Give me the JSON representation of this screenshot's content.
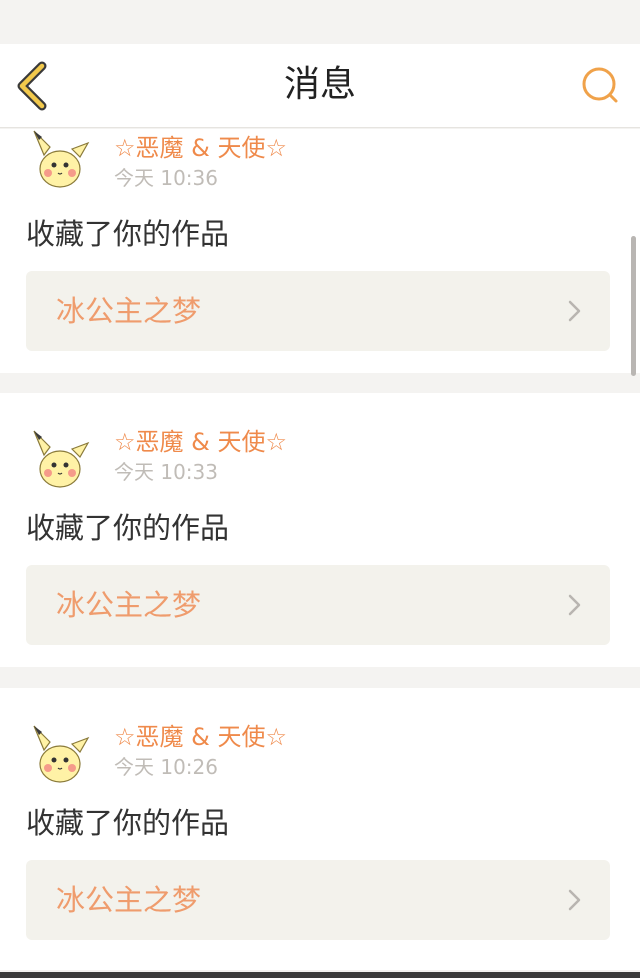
{
  "header": {
    "title": "消息",
    "back_icon": "chevron-left-icon",
    "search_icon": "search-icon",
    "accent": "#f0a24a"
  },
  "messages": [
    {
      "user": "☆恶魔 & 天使☆",
      "time": "今天 10:36",
      "action": "收藏了你的作品",
      "work": "冰公主之梦"
    },
    {
      "user": "☆恶魔 & 天使☆",
      "time": "今天 10:33",
      "action": "收藏了你的作品",
      "work": "冰公主之梦"
    },
    {
      "user": "☆恶魔 & 天使☆",
      "time": "今天 10:26",
      "action": "收藏了你的作品",
      "work": "冰公主之梦"
    }
  ],
  "colors": {
    "name": "#ef8a4b",
    "work_title": "#ef9c6d",
    "time": "#c0bcb7",
    "card_bg": "#ffffff",
    "page_bg": "#f4f3f1"
  }
}
